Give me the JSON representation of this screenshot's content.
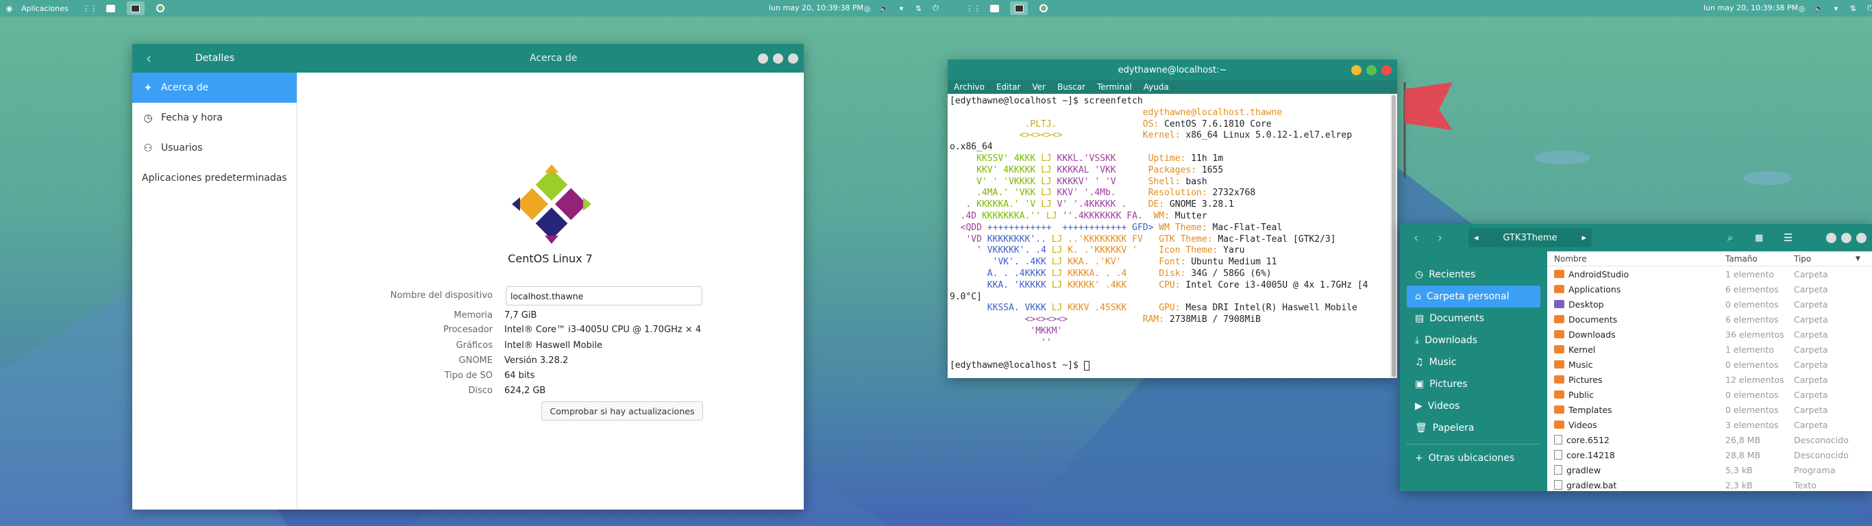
{
  "topbar": {
    "left": {
      "apps_label": "Aplicaciones",
      "clock": "lun may 20, 10:39:38 PM"
    },
    "right": {
      "clock": "lun may 20, 10:39:38 PM"
    }
  },
  "details": {
    "back_label": "‹",
    "sidebar_title": "Detalles",
    "main_title": "Acerca de",
    "sidebar": [
      {
        "label": "Acerca de",
        "icon": "star-icon"
      },
      {
        "label": "Fecha y hora",
        "icon": "clock-icon"
      },
      {
        "label": "Usuarios",
        "icon": "user-icon"
      },
      {
        "label": "Aplicaciones predeterminadas",
        "icon": ""
      }
    ],
    "os_name": "CentOS Linux 7",
    "device_label": "Nombre del dispositivo",
    "device_value": "localhost.thawne",
    "rows": [
      {
        "label": "Memoria",
        "value": "7,7 GiB"
      },
      {
        "label": "Procesador",
        "value": "Intel® Core™ i3-4005U CPU @ 1.70GHz × 4"
      },
      {
        "label": "Gráficos",
        "value": "Intel® Haswell Mobile"
      },
      {
        "label": "GNOME",
        "value": "Versión 3.28.2"
      },
      {
        "label": "Tipo de SO",
        "value": "64 bits"
      },
      {
        "label": "Disco",
        "value": "624,2 GB"
      }
    ],
    "update_button": "Comprobar si hay actualizaciones"
  },
  "terminal": {
    "title": "edythawne@localhost:~",
    "menu": [
      "Archivo",
      "Editar",
      "Ver",
      "Buscar",
      "Terminal",
      "Ayuda"
    ],
    "prompt1": "[edythawne@localhost ~]$ screenfetch",
    "prompt2": "[edythawne@localhost ~]$ ",
    "user_host": "edythawne@localhost.thawne",
    "info": [
      {
        "k": "OS:",
        "v": " CentOS 7.6.1810 Core"
      },
      {
        "k": "Kernel:",
        "v": " x86_64 Linux 5.0.12-1.el7.elrep"
      },
      {
        "k": "Uptime:",
        "v": " 11h 1m"
      },
      {
        "k": "Packages:",
        "v": " 1655"
      },
      {
        "k": "Shell:",
        "v": " bash"
      },
      {
        "k": "Resolution:",
        "v": " 2732x768"
      },
      {
        "k": "DE:",
        "v": " GNOME 3.28.1"
      },
      {
        "k": "WM:",
        "v": " Mutter"
      },
      {
        "k": "WM Theme:",
        "v": " Mac-Flat-Teal"
      },
      {
        "k": "GTK Theme:",
        "v": " Mac-Flat-Teal [GTK2/3]"
      },
      {
        "k": "Icon Theme:",
        "v": " Yaru"
      },
      {
        "k": "Font:",
        "v": " Ubuntu Medium 11"
      },
      {
        "k": "Disk:",
        "v": " 34G / 586G (6%)"
      },
      {
        "k": "CPU:",
        "v": " Intel Core i3-4005U @ 4x 1.7GHz [4"
      },
      {
        "k": "GPU:",
        "v": " Mesa DRI Intel(R) Haswell Mobile"
      },
      {
        "k": "RAM:",
        "v": " 2738MiB / 7908MiB"
      }
    ],
    "wrap1": "o.x86_64",
    "wrap2": "9.0°C]"
  },
  "files": {
    "path": "GTK3Theme",
    "sidebar": [
      {
        "label": "Recientes",
        "icon": "clock-icon"
      },
      {
        "label": "Carpeta personal",
        "icon": "home-icon"
      },
      {
        "label": "Documents",
        "icon": "document-icon"
      },
      {
        "label": "Downloads",
        "icon": "download-icon"
      },
      {
        "label": "Music",
        "icon": "music-icon"
      },
      {
        "label": "Pictures",
        "icon": "picture-icon"
      },
      {
        "label": "Videos",
        "icon": "video-icon"
      },
      {
        "label": "Papelera",
        "icon": "trash-icon"
      },
      {
        "label": "Otras ubicaciones",
        "icon": "plus-icon"
      }
    ],
    "columns": [
      "Nombre",
      "Tamaño",
      "Tipo"
    ],
    "rows": [
      {
        "name": "AndroidStudio",
        "size": "1 elemento",
        "type": "Carpeta",
        "kind": "folder"
      },
      {
        "name": "Applications",
        "size": "6 elementos",
        "type": "Carpeta",
        "kind": "folder"
      },
      {
        "name": "Desktop",
        "size": "0 elementos",
        "type": "Carpeta",
        "kind": "folder-purple"
      },
      {
        "name": "Documents",
        "size": "6 elementos",
        "type": "Carpeta",
        "kind": "folder"
      },
      {
        "name": "Downloads",
        "size": "36 elementos",
        "type": "Carpeta",
        "kind": "folder"
      },
      {
        "name": "Kernel",
        "size": "1 elemento",
        "type": "Carpeta",
        "kind": "folder"
      },
      {
        "name": "Music",
        "size": "0 elementos",
        "type": "Carpeta",
        "kind": "folder"
      },
      {
        "name": "Pictures",
        "size": "12 elementos",
        "type": "Carpeta",
        "kind": "folder"
      },
      {
        "name": "Public",
        "size": "0 elementos",
        "type": "Carpeta",
        "kind": "folder"
      },
      {
        "name": "Templates",
        "size": "0 elementos",
        "type": "Carpeta",
        "kind": "folder"
      },
      {
        "name": "Videos",
        "size": "3 elementos",
        "type": "Carpeta",
        "kind": "folder"
      },
      {
        "name": "core.6512",
        "size": "26,8 MB",
        "type": "Desconocido",
        "kind": "file"
      },
      {
        "name": "core.14218",
        "size": "28,8 MB",
        "type": "Desconocido",
        "kind": "file"
      },
      {
        "name": "gradlew",
        "size": "5,3 kB",
        "type": "Programa",
        "kind": "file"
      },
      {
        "name": "gradlew.bat",
        "size": "2,3 kB",
        "type": "Texto",
        "kind": "file"
      }
    ]
  }
}
